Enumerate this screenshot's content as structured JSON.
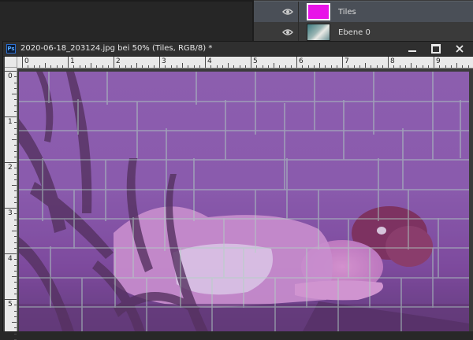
{
  "layers": [
    {
      "name": "Tiles",
      "selected": true,
      "thumb": "fill",
      "color": "#e814e8"
    },
    {
      "name": "Ebene 0",
      "selected": false,
      "thumb": "image"
    }
  ],
  "document": {
    "title": "2020-06-18_203124.jpg bei 50% (Tiles, RGB/8) *",
    "app_icon": "Ps"
  },
  "ruler": {
    "top_labels": [
      "0",
      "1",
      "2",
      "3",
      "4",
      "5",
      "6",
      "7",
      "8",
      "9"
    ],
    "left_labels": [
      "0",
      "1",
      "2",
      "3",
      "4",
      "5"
    ]
  },
  "icons": {
    "visibility": "eye-icon",
    "minimize": "minimize-icon",
    "maximize": "maximize-icon",
    "close": "close-icon"
  },
  "colors": {
    "tint": "#8a4fb8",
    "tile_edge": "#b9f0c6",
    "panel_selected": "#4a4f57"
  }
}
